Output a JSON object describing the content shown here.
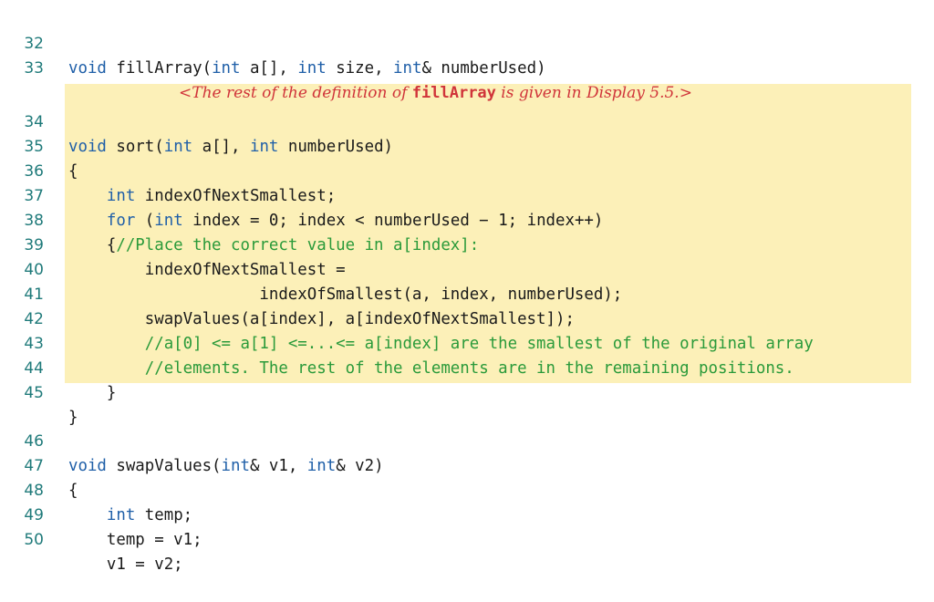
{
  "listing": {
    "line32": {
      "num": "32",
      "t1": "void",
      "t2": " fillArray(",
      "t3": "int",
      "t4": " a[], ",
      "t5": "int",
      "t6": " size, ",
      "t7": "int",
      "t8": "& numberUsed)"
    },
    "line33": {
      "num": "33",
      "pre": "<The rest of the definition of ",
      "fn": "fillArray",
      "post": " is given in Display 5.5.>"
    },
    "line34": {
      "num": "34",
      "t1": "void",
      "t2": " sort(",
      "t3": "int",
      "t4": " a[], ",
      "t5": "int",
      "t6": " numberUsed)"
    },
    "line35": {
      "num": "35",
      "t1": "{"
    },
    "line36": {
      "num": "36",
      "t1": "    ",
      "t2": "int",
      "t3": " indexOfNextSmallest;"
    },
    "line37": {
      "num": "37",
      "t1": "    ",
      "t2": "for",
      "t3": " (",
      "t4": "int",
      "t5": " index = 0; index < numberUsed − 1; index++)"
    },
    "line38": {
      "num": "38",
      "t1": "    {",
      "t2": "//Place the correct value in a[index]:"
    },
    "line39": {
      "num": "39",
      "t1": "        indexOfNextSmallest ="
    },
    "line40": {
      "num": "40",
      "t1": "                    indexOfSmallest(a, index, numberUsed);"
    },
    "line41": {
      "num": "41",
      "t1": "        swapValues(a[index], a[indexOfNextSmallest]);"
    },
    "line42": {
      "num": "42",
      "t1": "        ",
      "t2": "//a[0] <= a[1] <=...<= a[index] are the smallest of the original array"
    },
    "line43": {
      "num": "43",
      "t1": "        ",
      "t2": "//elements. The rest of the elements are in the remaining positions."
    },
    "line44": {
      "num": "44",
      "t1": "    }"
    },
    "line45": {
      "num": "45",
      "t1": "}"
    },
    "line46": {
      "num": "46",
      "t1": "void",
      "t2": " swapValues(",
      "t3": "int",
      "t4": "& v1, ",
      "t5": "int",
      "t6": "& v2)"
    },
    "line47": {
      "num": "47",
      "t1": "{"
    },
    "line48": {
      "num": "48",
      "t1": "    ",
      "t2": "int",
      "t3": " temp;"
    },
    "line49": {
      "num": "49",
      "t1": "    temp = v1;"
    },
    "line50": {
      "num": "50",
      "t1": "    v1 = v2;"
    }
  },
  "colors": {
    "keyword": "#1f5fa8",
    "comment": "#2a9a3a",
    "line_number": "#1f7a7a",
    "note": "#d0343a",
    "highlight": "#fcf0b8"
  }
}
